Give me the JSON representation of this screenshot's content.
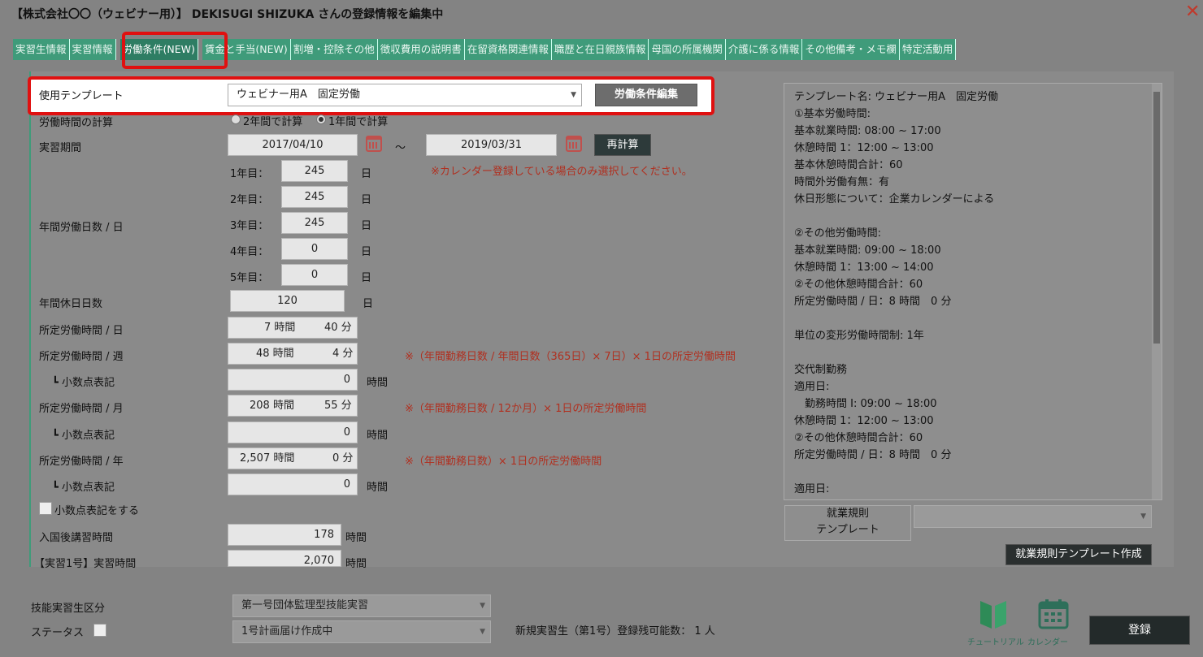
{
  "window": {
    "title": "【株式会社〇〇（ウェビナー用）】 DEKISUGI SHIZUKA さんの登録情報を編集中",
    "close_label": "✕"
  },
  "tabs": [
    {
      "label": "実習生情報"
    },
    {
      "label": "実習情報"
    },
    {
      "label": "労働条件(NEW)",
      "active": true
    },
    {
      "label": "賃金と手当(NEW)"
    },
    {
      "label": "割増・控除その他"
    },
    {
      "label": "徴収費用の説明書"
    },
    {
      "label": "在留資格関連情報"
    },
    {
      "label": "職歴と在日親族情報"
    },
    {
      "label": "母国の所属機関"
    },
    {
      "label": "介護に係る情報"
    },
    {
      "label": "その他備考・メモ欄"
    },
    {
      "label": "特定活動用"
    }
  ],
  "form": {
    "template_label": "使用テンプレート",
    "template_value": "ウェビナー用A　固定労働",
    "template_edit_button": "労働条件編集",
    "calc_label": "労働時間の計算",
    "calc_option_2year": "2年間で計算",
    "calc_option_1year": "1年間で計算",
    "period_label": "実習期間",
    "period_start": "2017/04/10",
    "period_tilde": "～",
    "period_end": "2019/03/31",
    "recalc_button": "再計算",
    "calendar_note": "※カレンダー登録している場合のみ選択してください。",
    "annual_days_label": "年間労働日数 / 日",
    "years": [
      {
        "label": "1年目：",
        "value": "245",
        "unit": "日"
      },
      {
        "label": "2年目：",
        "value": "245",
        "unit": "日"
      },
      {
        "label": "3年目：",
        "value": "245",
        "unit": "日"
      },
      {
        "label": "4年目：",
        "value": "0",
        "unit": "日"
      },
      {
        "label": "5年目：",
        "value": "0",
        "unit": "日"
      }
    ],
    "holidays_label": "年間休日日数",
    "holidays_value": "120",
    "holidays_unit": "日",
    "daily_label": "所定労働時間 / 日",
    "daily_hours": "7 時間",
    "daily_minutes": "40 分",
    "weekly_label": "所定労働時間 / 週",
    "weekly_hours": "48 時間",
    "weekly_minutes": "4 分",
    "weekly_note": "※（年間勤務日数 / 年間日数（365日）× 7日）× 1日の所定労働時間",
    "decimal_label": "┗ 小数点表記",
    "weekly_decimal": "0",
    "hour_unit": "時間",
    "monthly_label": "所定労働時間 / 月",
    "monthly_hours": "208 時間",
    "monthly_minutes": "55 分",
    "monthly_note": "※（年間勤務日数 / 12か月）× 1日の所定労働時間",
    "monthly_decimal": "0",
    "yearly_label": "所定労働時間 / 年",
    "yearly_hours": "2,507 時間",
    "yearly_minutes": "0 分",
    "yearly_note": "※（年間勤務日数）× 1日の所定労働時間",
    "yearly_decimal": "0",
    "decimal_checkbox_label": "小数点表記をする",
    "training_label": "入国後講習時間",
    "training_value": "178",
    "practice1_label": "【実習1号】実習時間",
    "practice1_value": "2,070"
  },
  "template_panel": {
    "lines": "テンプレート名: ウェビナー用A　固定労働\n①基本労働時間:\n基本就業時間: 08:00 ~ 17:00\n休憩時間 1：12:00 ~ 13:00\n基本休憩時間合計：60\n時間外労働有無：有\n休日形態について：企業カレンダーによる\n\n②その他労働時間:\n基本就業時間: 09:00 ~ 18:00\n休憩時間 1：13:00 ~ 14:00\n②その他休憩時間合計：60\n所定労働時間 / 日：8 時間　0 分\n\n単位の変形労働時間制: 1年\n\n交代制勤務\n適用日:\n　勤務時間 I: 09:00 ~ 18:00\n休憩時間 1：12:00 ~ 13:00\n②その他休憩時間合計：60\n所定労働時間 / 日：8 時間　0 分\n\n適用日:",
    "rules_label_line1": "就業規則",
    "rules_label_line2": "テンプレート",
    "rules_select_value": "",
    "rules_create_button": "就業規則テンプレート作成"
  },
  "footer": {
    "trainee_type_label": "技能実習生区分",
    "trainee_type_value": "第一号団体監理型技能実習",
    "status_label": "ステータス",
    "status_value": "1号計画届け作成中",
    "remaining_text": "新規実習生（第1号）登録残可能数： 1 人",
    "tutorial_label": "チュートリアル",
    "calendar_label": "カレンダー",
    "submit_button": "登録"
  },
  "colors": {
    "tab_green": "#3f9b7a",
    "highlight_red": "#e01010",
    "note_red": "#b03020"
  }
}
